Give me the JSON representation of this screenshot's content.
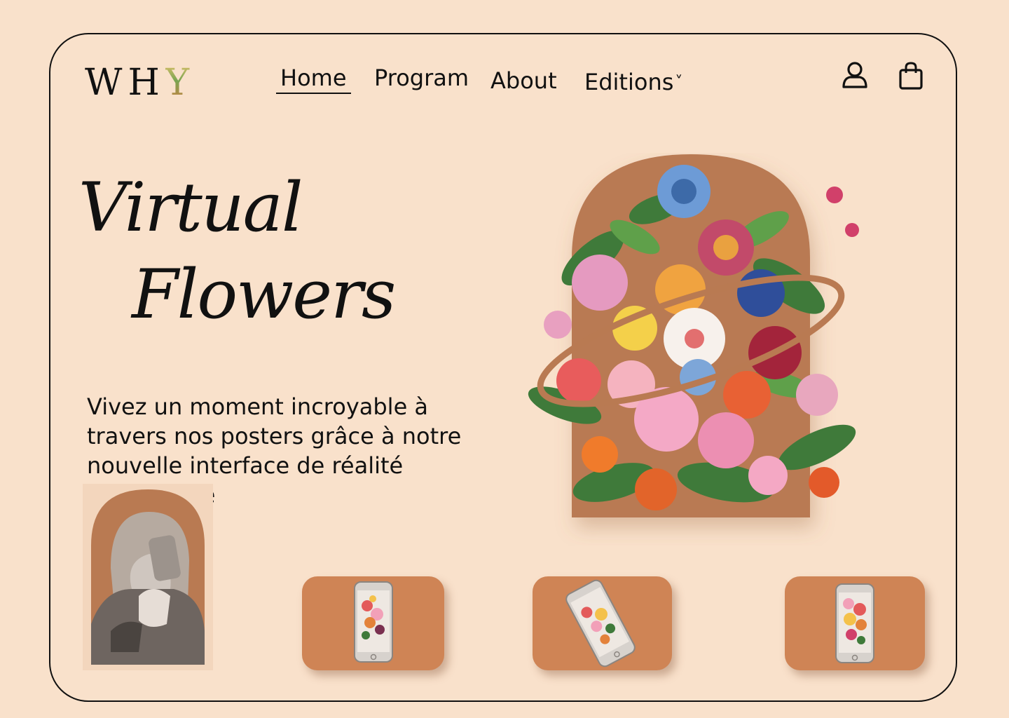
{
  "brand": {
    "logo_text_main": "WH",
    "logo_text_accent": "Y"
  },
  "nav": {
    "items": [
      {
        "label": "Home",
        "active": true
      },
      {
        "label": "Program",
        "active": false
      },
      {
        "label": "About",
        "active": false
      },
      {
        "label": "Editions",
        "active": false,
        "has_dropdown": true
      }
    ],
    "dropdown_glyph": "˅"
  },
  "header_icons": {
    "account_icon": "user-icon",
    "cart_icon": "shopping-bag-icon"
  },
  "hero": {
    "title_line1": "Virtual",
    "title_line2": "Flowers",
    "description": "Vivez un moment incroyable à travers nos posters grâce à notre nouvelle interface de réalité augmentée"
  },
  "cards": [
    {
      "name": "phone-card-1",
      "image": "phone-with-flowers-upright"
    },
    {
      "name": "phone-card-2",
      "image": "phone-with-flowers-tilted"
    },
    {
      "name": "phone-card-3",
      "image": "phone-with-flowers-upright"
    }
  ],
  "colors": {
    "background": "#f9e1cb",
    "accent_brown": "#b97a52",
    "card": "#cf8455",
    "text": "#111111"
  }
}
